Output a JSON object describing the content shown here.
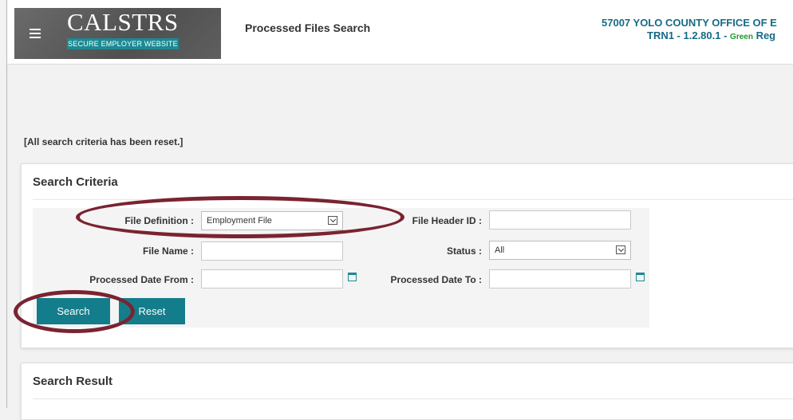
{
  "header": {
    "menu_icon": "hamburger-menu-icon",
    "logo_text": "CALSTRS",
    "logo_subtitle": "SECURE EMPLOYER WEBSITE",
    "page_title": "Processed Files Search",
    "org_line1": "57007 YOLO COUNTY OFFICE OF E",
    "org_line2_prefix": "TRN1 - 1.2.80.1 - ",
    "org_line2_env": "Green",
    "org_line2_suffix": " Reg"
  },
  "message": "[All search criteria has been reset.]",
  "search_criteria": {
    "title": "Search Criteria",
    "file_definition_label": "File Definition :",
    "file_definition_value": "Employment File",
    "file_header_id_label": "File Header ID :",
    "file_header_id_value": "",
    "file_name_label": "File Name :",
    "file_name_value": "",
    "status_label": "Status :",
    "status_value": "All",
    "processed_date_from_label": "Processed Date From :",
    "processed_date_to_label": "Processed Date To :",
    "search_button": "Search",
    "reset_button": "Reset"
  },
  "search_result": {
    "title": "Search Result"
  },
  "colors": {
    "accent": "#137d8b",
    "annotation": "#7a2331",
    "org_text": "#156b86",
    "env_green": "#1c9a2a"
  }
}
